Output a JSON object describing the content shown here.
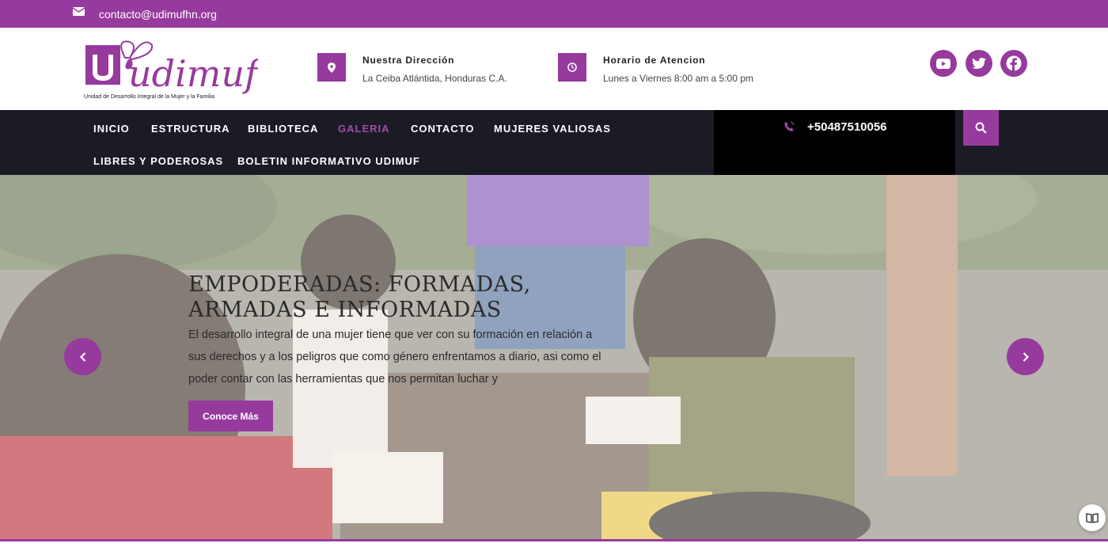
{
  "topbar": {
    "email": "contacto@udimufhn.org",
    "icon": "envelope-icon"
  },
  "logo": {
    "name": "udimuf",
    "subtitle": "Unidad de Desarrollo Integral de la Mujer y la Familia"
  },
  "address": {
    "title": "Nuestra Dirección",
    "text": "La Ceiba Atlántida, Honduras C.A.",
    "icon": "map-pin-icon"
  },
  "hours": {
    "title": "Horario de Atencion",
    "text": "Lunes a Viernes 8:00 am a 5:00 pm",
    "icon": "clock-icon"
  },
  "social": [
    "youtube-icon",
    "twitter-icon",
    "facebook-icon"
  ],
  "nav": {
    "items": [
      "INICIO",
      "ESTRUCTURA",
      "BIBLIOTECA",
      "GALERIA",
      "CONTACTO",
      "MUJERES VALIOSAS",
      "LIBRES Y PODEROSAS",
      "BOLETIN INFORMATIVO UDIMUF"
    ],
    "active": "GALERIA",
    "phone": "+50487510056"
  },
  "hero": {
    "title": "EMPODERADAS: FORMADAS, ARMADAS E INFORMADAS",
    "text": "El desarrollo integral de una mujer tiene que ver con su formación en relación a sus derechos y a los peligros que como género enfrentamos a diario, asi como el poder contar con las herramientas que nos permitan luchar y",
    "button": "Conoce Más"
  },
  "colors": {
    "brand": "#973a9e",
    "nav_bg": "#1b1b26",
    "phone_bg": "#000000"
  }
}
